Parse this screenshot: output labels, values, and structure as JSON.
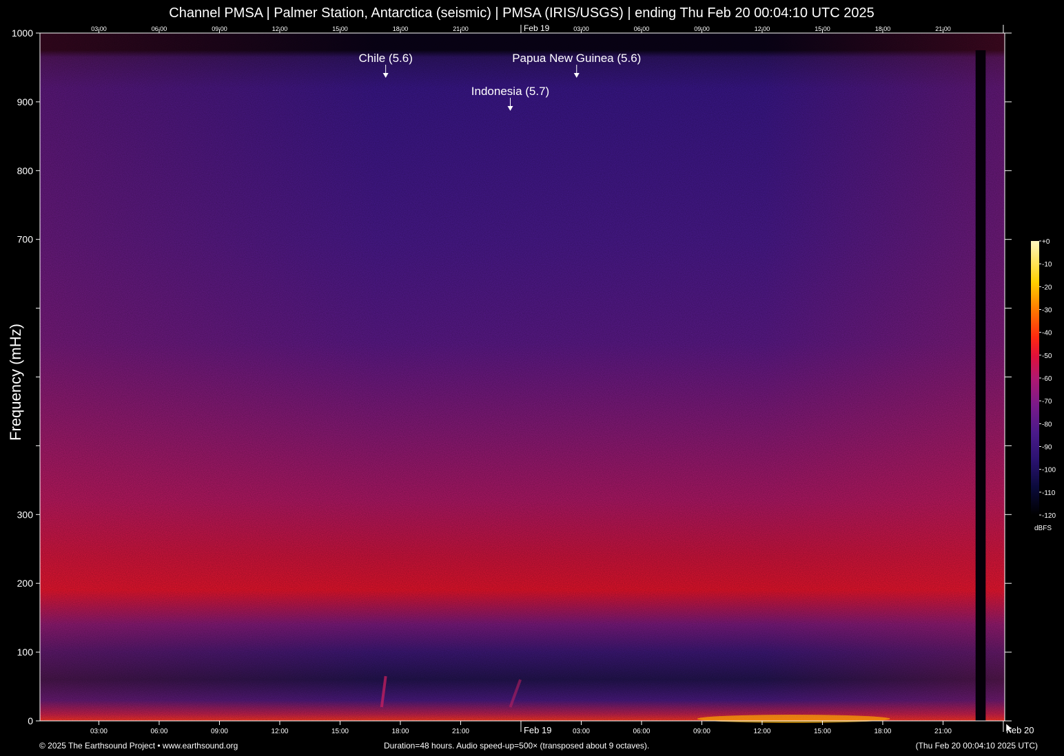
{
  "header": {
    "title": "Channel PMSA | Palmer Station, Antarctica (seismic) | PMSA (IRIS/USGS) | ending Thu Feb 20 00:04:10 UTC 2025"
  },
  "footer": {
    "copyright": "© 2025 The Earthsound Project • www.earthsound.org",
    "info": "Duration=48 hours. Audio speed-up=500× (transposed about 9 octaves).",
    "timestamp": "(Thu Feb 20 00:04:10 2025 UTC)"
  },
  "colors": {
    "background": "#000000",
    "axis": "#ffffff",
    "band_low": "#4a1a8a",
    "band_mid": "#e0103a",
    "hot": "#ffd000"
  },
  "chart_data": {
    "type": "heatmap",
    "title": "Channel PMSA | Palmer Station, Antarctica (seismic) | PMSA (IRIS/USGS) | ending Thu Feb 20 00:04:10 UTC 2025",
    "xlabel": "",
    "ylabel": "Frequency (mHz)",
    "x_unit": "hours over a 48-hour window ending Thu Feb 20 00:04:10 UTC 2025",
    "xlim": [
      0,
      48
    ],
    "ylim": [
      0,
      1000
    ],
    "grid": false,
    "x_ticks": [
      {
        "x": 2.93,
        "label": "03:00"
      },
      {
        "x": 5.93,
        "label": "06:00"
      },
      {
        "x": 8.93,
        "label": "09:00"
      },
      {
        "x": 11.93,
        "label": "12:00"
      },
      {
        "x": 14.93,
        "label": "15:00"
      },
      {
        "x": 17.93,
        "label": "18:00"
      },
      {
        "x": 20.93,
        "label": "21:00"
      },
      {
        "x": 23.93,
        "label": "Feb 19"
      },
      {
        "x": 26.93,
        "label": "03:00"
      },
      {
        "x": 29.93,
        "label": "06:00"
      },
      {
        "x": 32.93,
        "label": "09:00"
      },
      {
        "x": 35.93,
        "label": "12:00"
      },
      {
        "x": 38.93,
        "label": "15:00"
      },
      {
        "x": 41.93,
        "label": "18:00"
      },
      {
        "x": 44.93,
        "label": "21:00"
      },
      {
        "x": 47.93,
        "label": "Feb 20"
      }
    ],
    "y_ticks": [
      {
        "y": 0,
        "label": "0"
      },
      {
        "y": 100,
        "label": "100"
      },
      {
        "y": 200,
        "label": "200"
      },
      {
        "y": 300,
        "label": "300"
      },
      {
        "y": 400,
        "label": ""
      },
      {
        "y": 500,
        "label": ""
      },
      {
        "y": 600,
        "label": ""
      },
      {
        "y": 700,
        "label": "700"
      },
      {
        "y": 800,
        "label": "800"
      },
      {
        "y": 900,
        "label": "900"
      },
      {
        "y": 1000,
        "label": "1000"
      }
    ],
    "annotations": [
      {
        "label": "Chile (5.6)",
        "x": 17.2
      },
      {
        "label": "Indonesia (5.7)",
        "x": 23.4
      },
      {
        "label": "Papua New Guinea (5.6)",
        "x": 26.7
      }
    ],
    "intensity_profile": {
      "description_units": "dBFS level vs frequency (mHz)",
      "frequency": [
        0,
        20,
        50,
        80,
        100,
        130,
        150,
        170,
        200,
        250,
        300,
        400,
        500,
        600,
        700,
        800,
        900,
        960,
        980,
        1000
      ],
      "level": [
        -45,
        -60,
        -100,
        -88,
        -90,
        -95,
        -85,
        -58,
        -52,
        -62,
        -70,
        -78,
        -84,
        -88,
        -92,
        -94,
        -96,
        -98,
        -120,
        -120
      ]
    },
    "data_gap": {
      "x_start": 46.55,
      "x_end": 47.05
    },
    "colorbar": {
      "label": "dBFS",
      "range": [
        -120,
        0
      ],
      "ticks": [
        "+0",
        "-10",
        "-20",
        "-30",
        "-40",
        "-50",
        "-60",
        "-70",
        "-80",
        "-90",
        "-100",
        "-110",
        "-120"
      ],
      "colors": [
        "#000000",
        "#0a0a3a",
        "#2a1270",
        "#4a1a8a",
        "#7a1a8a",
        "#b01870",
        "#e0103a",
        "#ff2a10",
        "#ff7a00",
        "#ffd000",
        "#fff8c0"
      ]
    }
  }
}
